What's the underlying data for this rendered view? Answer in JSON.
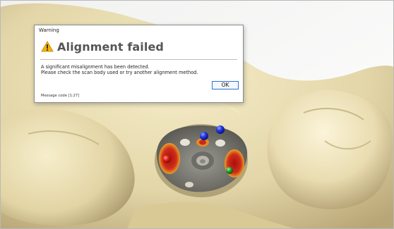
{
  "dialog": {
    "window_title": "Warning",
    "icon": "warning-triangle-icon",
    "heading": "Alignment failed",
    "message_line1": "A significant misalignment has been detected.",
    "message_line2": "Please check the scan body used or try another alignment method.",
    "ok_label": "OK",
    "message_code": "Message code [1:27]"
  },
  "scene": {
    "description_colors": {
      "gingiva": "#e8dcae",
      "background": "#ffffff",
      "marker_red": "#d8261c",
      "marker_blue": "#1d36d8",
      "marker_green": "#1f9a2a",
      "scanbody_gray": "#7d7c74"
    }
  }
}
